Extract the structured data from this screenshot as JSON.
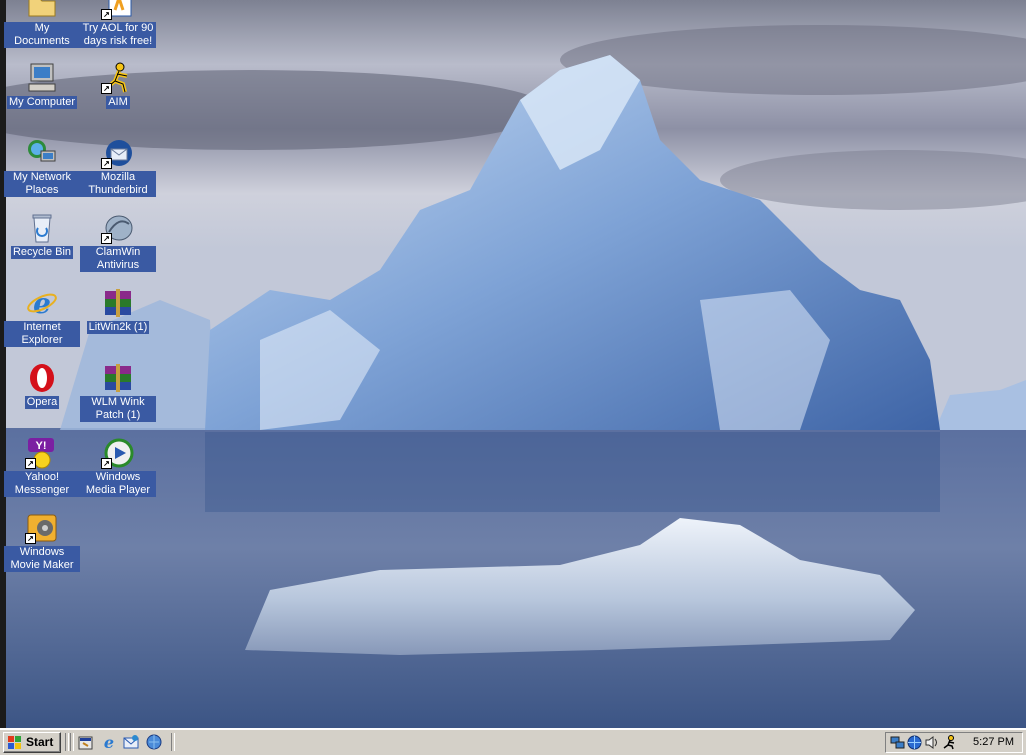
{
  "desktop": {
    "icons_left": [
      {
        "label": "My Documents",
        "icon": "folder-icon"
      },
      {
        "label": "My Computer",
        "icon": "computer-icon"
      },
      {
        "label": "My Network Places",
        "icon": "network-icon"
      },
      {
        "label": "Recycle Bin",
        "icon": "recycle-bin-icon"
      },
      {
        "label": "Internet Explorer",
        "icon": "ie-icon"
      },
      {
        "label": "Opera",
        "icon": "opera-icon"
      },
      {
        "label": "Yahoo! Messenger",
        "icon": "yahoo-messenger-icon"
      },
      {
        "label": "Windows Movie Maker",
        "icon": "movie-maker-icon"
      }
    ],
    "icons_right": [
      {
        "label": "Try AOL for 90 days risk free!",
        "icon": "aol-icon"
      },
      {
        "label": "AIM",
        "icon": "aim-icon"
      },
      {
        "label": "Mozilla Thunderbird",
        "icon": "thunderbird-icon"
      },
      {
        "label": "ClamWin Antivirus",
        "icon": "clamwin-icon"
      },
      {
        "label": "LitWin2k (1)",
        "icon": "winrar-archive-icon"
      },
      {
        "label": "WLM Wink Patch (1)",
        "icon": "winrar-archive-icon"
      },
      {
        "label": "Windows Media Player",
        "icon": "media-player-icon"
      }
    ]
  },
  "taskbar": {
    "start_label": "Start",
    "quick_launch": [
      "show-desktop-icon",
      "internet-explorer-icon",
      "outlook-express-icon",
      "web-browser-icon"
    ],
    "tray_icons": [
      "network-tray-icon",
      "globe-tray-icon",
      "volume-icon",
      "aim-tray-icon"
    ],
    "clock": "5:27 PM"
  },
  "colors": {
    "label_bg": "#3a5aa3",
    "taskbar_bg": "#d4d0c8"
  }
}
